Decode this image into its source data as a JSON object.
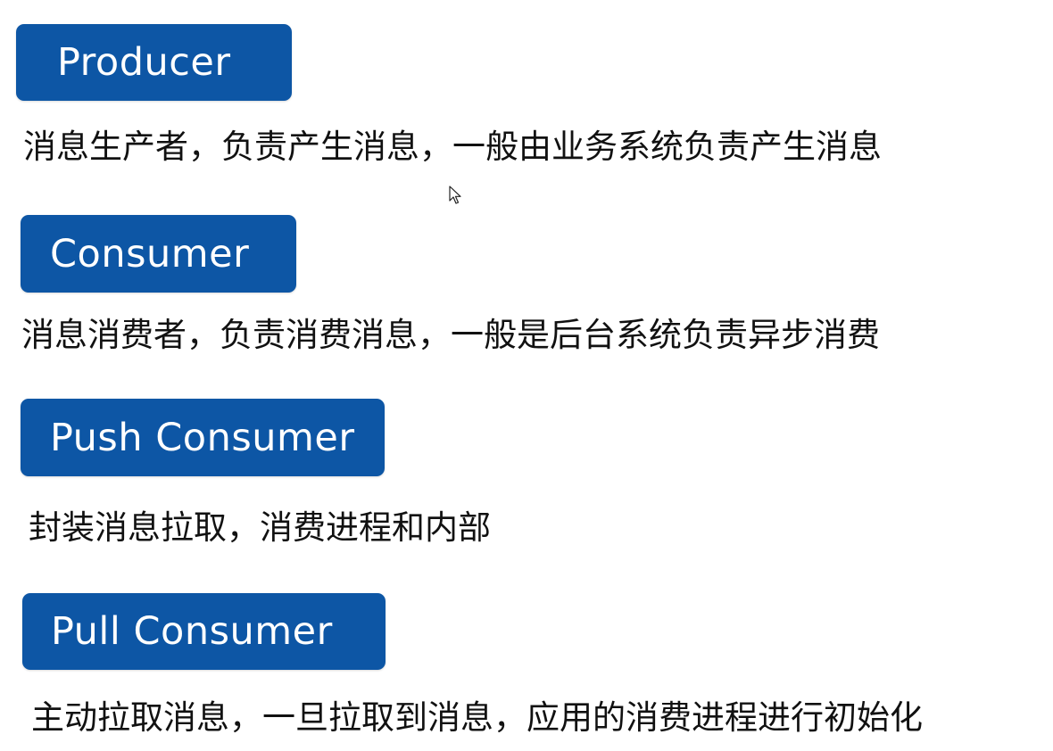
{
  "colors": {
    "tag_background": "#0d56a5",
    "tag_text": "#ffffff",
    "description_text": "#111111"
  },
  "sections": [
    {
      "tag": "Producer",
      "description": "消息生产者，负责产生消息，一般由业务系统负责产生消息"
    },
    {
      "tag": "Consumer",
      "description": "消息消费者，负责消费消息，一般是后台系统负责异步消费"
    },
    {
      "tag": "Push Consumer",
      "description": "封装消息拉取，消费进程和内部"
    },
    {
      "tag": "Pull Consumer",
      "description": "主动拉取消息，一旦拉取到消息，应用的消费进程进行初始化"
    }
  ],
  "cursor_icon": "mouse-pointer-icon"
}
